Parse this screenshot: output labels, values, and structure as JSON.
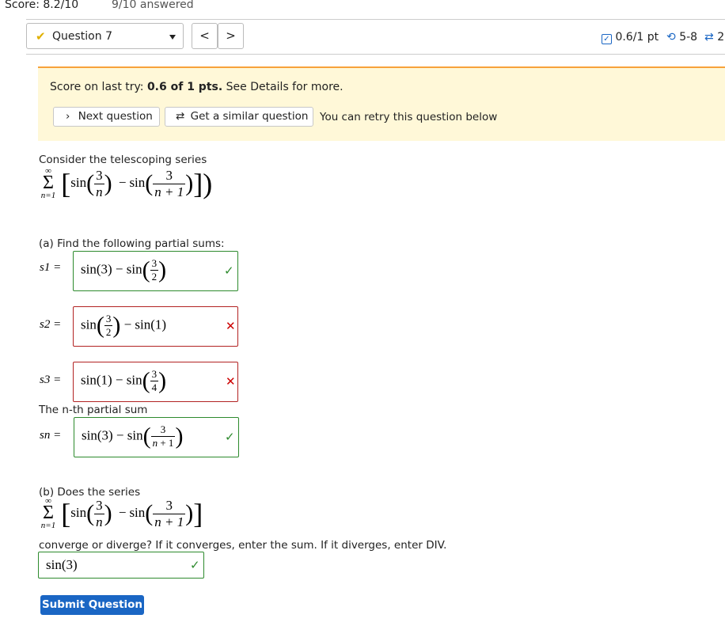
{
  "topbar": {
    "score": "Score: 8.2/10",
    "answered": "9/10 answered"
  },
  "nav": {
    "question_label": "Question 7",
    "prev_glyph": "<",
    "next_glyph": ">"
  },
  "right_info": {
    "points": "0.6/1 pt",
    "attempts": "5-8",
    "more": "2"
  },
  "banner": {
    "text_prefix": "Score on last try: ",
    "score_bold": "0.6 of 1 pts.",
    "text_suffix": " See Details for more.",
    "next_btn": "Next question",
    "similar_btn": "Get a similar question",
    "retry_text": "You can retry this question below"
  },
  "question": {
    "intro": "Consider the telescoping series",
    "part_a": "(a) Find the following partial sums:",
    "nth_label": "The n-th partial sum",
    "part_b": "(b) Does the series",
    "part_b_end": "converge or diverge? If it converges, enter the sum. If it diverges, enter DIV.",
    "series": {
      "sum_top": "∞",
      "sum_bottom": "n=1",
      "sin": "sin",
      "num": "3",
      "den1": "n",
      "den2": "n + 1",
      "minus": "−"
    }
  },
  "answers": [
    {
      "label": "s1 =",
      "status": "correct",
      "display": "sin(3) − sin(3/2)"
    },
    {
      "label": "s2 =",
      "status": "incorrect",
      "display": "sin(3/2) − sin(1)"
    },
    {
      "label": "s3 =",
      "status": "incorrect",
      "display": "sin(1) − sin(3/4)"
    },
    {
      "label": "sn =",
      "status": "correct",
      "display": "sin(3) − sin(3/(n+1))"
    }
  ],
  "part_b_answer": {
    "display": "sin(3)",
    "status": "correct"
  },
  "submit": "Submit Question",
  "colors": {
    "correct": "#2d8a2d",
    "incorrect": "#b22222",
    "banner_bg": "#fff8d8",
    "banner_border": "#f7a23a",
    "submit_bg": "#1a66c4"
  }
}
